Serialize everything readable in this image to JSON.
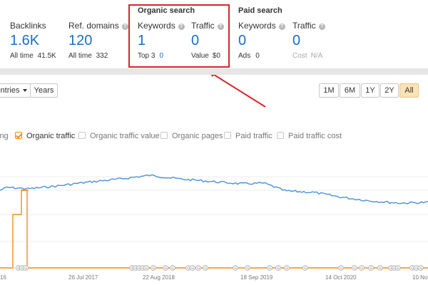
{
  "metrics": {
    "backlinks": {
      "label": "Backlinks",
      "value": "1.6K",
      "sub_label": "All time",
      "sub_value": "41.5K"
    },
    "ref_domains": {
      "label": "Ref. domains",
      "value": "120",
      "sub_label": "All time",
      "sub_value": "332"
    },
    "organic": {
      "title": "Organic search",
      "keywords": {
        "label": "Keywords",
        "value": "1",
        "sub_label": "Top 3",
        "sub_value": "0"
      },
      "traffic": {
        "label": "Traffic",
        "value": "0",
        "sub_label": "Value",
        "sub_value": "$0"
      }
    },
    "paid": {
      "title": "Paid search",
      "keywords": {
        "label": "Keywords",
        "value": "0",
        "sub_label": "Ads",
        "sub_value": "0"
      },
      "traffic": {
        "label": "Traffic",
        "value": "0",
        "sub_label": "Cost",
        "sub_value": "N/A"
      }
    }
  },
  "toolbar": {
    "countries_label": "ntries",
    "years_label": "Years",
    "ranges": [
      "1M",
      "6M",
      "1Y",
      "2Y",
      "All"
    ],
    "active_range": "All"
  },
  "legend": [
    {
      "label": "ing",
      "checked": false,
      "partial": true
    },
    {
      "label": "Organic traffic",
      "checked": true
    },
    {
      "label": "Organic traffic value",
      "checked": false
    },
    {
      "label": "Organic pages",
      "checked": false
    },
    {
      "label": "Paid traffic",
      "checked": false
    },
    {
      "label": "Paid traffic cost",
      "checked": false
    }
  ],
  "chart_data": {
    "type": "line",
    "x_tick_labels": [
      "16",
      "26 Jul 2017",
      "22 Aug 2018",
      "18 Sep 2019",
      "14 Oct 2020",
      "10 Nov"
    ],
    "colors": {
      "blue_series": "#4a90d9",
      "orange_series": "#f08c18",
      "annotation": "#d9242a"
    },
    "grid": true,
    "marker_label": "G"
  }
}
